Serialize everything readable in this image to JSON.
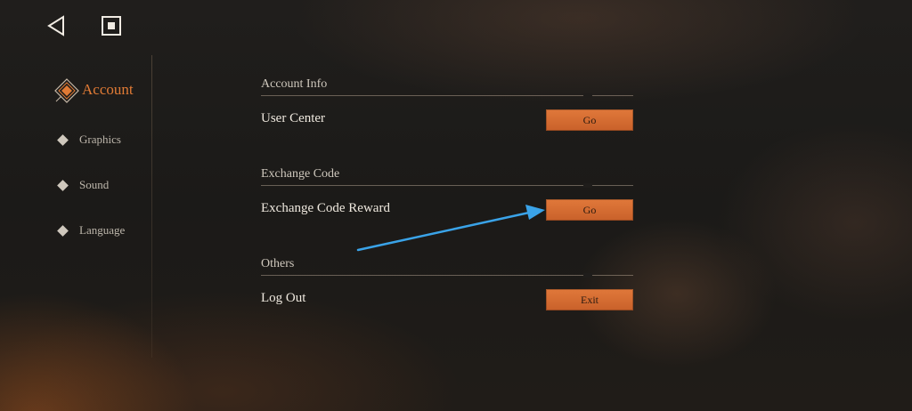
{
  "nav": {
    "back_icon": "back-triangle-icon",
    "home_icon": "square-home-icon"
  },
  "sidebar": {
    "items": [
      {
        "label": "Account",
        "active": true
      },
      {
        "label": "Graphics",
        "active": false
      },
      {
        "label": "Sound",
        "active": false
      },
      {
        "label": "Language",
        "active": false
      }
    ]
  },
  "sections": [
    {
      "title": "Account Info",
      "row_label": "User Center",
      "button_label": "Go"
    },
    {
      "title": "Exchange Code",
      "row_label": "Exchange Code Reward",
      "button_label": "Go"
    },
    {
      "title": "Others",
      "row_label": "Log Out",
      "button_label": "Exit"
    }
  ],
  "colors": {
    "accent": "#e07a35",
    "button": "#d56d31",
    "background": "#1b1a18",
    "annotation_arrow": "#3aa3e8"
  }
}
